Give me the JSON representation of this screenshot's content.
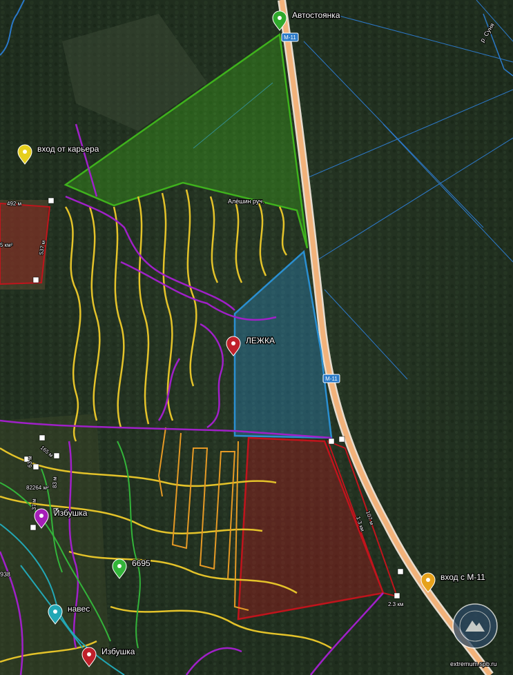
{
  "map": {
    "markers": [
      {
        "id": "parking",
        "label": "Автостоянка",
        "color": "#2fa82c"
      },
      {
        "id": "quarry",
        "label": "вход от карьера",
        "color": "#e6cf1d"
      },
      {
        "id": "lezhka",
        "label": "ЛЕЖКА",
        "color": "#c0202a"
      },
      {
        "id": "izbushka1",
        "label": "Избушка",
        "color": "#a61fb8"
      },
      {
        "id": "p6695",
        "label": "6695",
        "color": "#33b43a"
      },
      {
        "id": "naves",
        "label": "навес",
        "color": "#22a7b5"
      },
      {
        "id": "izbushka2",
        "label": "Избушка",
        "color": "#c0202a"
      },
      {
        "id": "m11",
        "label": "вход с М-11",
        "color": "#e6a21c"
      }
    ],
    "road_shields": [
      "M-11",
      "M-11"
    ],
    "river_label": "р. Суня",
    "stream_label": "Алёшин руч.",
    "measurements": {
      "m492": "492 м",
      "m537": "537 м",
      "m5km2": "5 км²",
      "m82264": "82264 м²",
      "m165": "165 м",
      "m83": "83 м",
      "m37": "37 м",
      "m63": "63 м",
      "m938": "938",
      "m23km": "2.3 км",
      "m107": "107 м",
      "m137": "1.3 км"
    },
    "watermark": "extremum.spb.ru",
    "colors": {
      "green_area": "#3fb21d",
      "blue_area": "#2a8fd1",
      "red_area": "#c0141c",
      "track_yellow": "#e4c32a",
      "track_purple": "#a020c8",
      "track_orange": "#e69a25",
      "road": "#f2b27a",
      "grid_lines": "#2f86e8"
    }
  }
}
